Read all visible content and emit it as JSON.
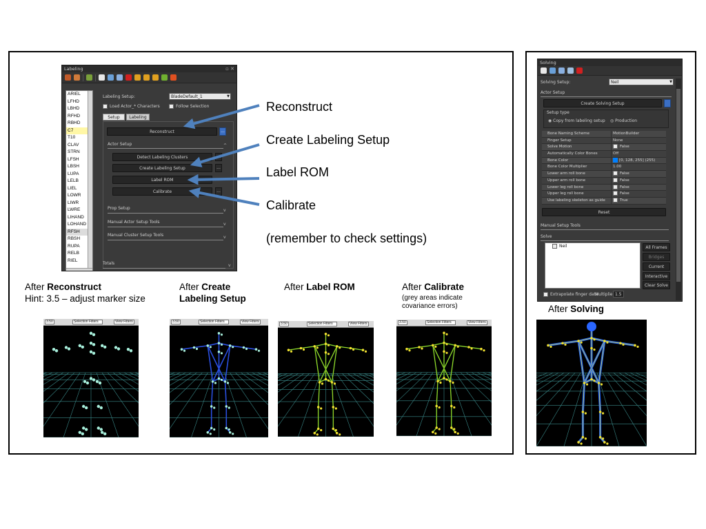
{
  "labeling_panel": {
    "title": "Labeling",
    "setup_label": "Labeling Setup:",
    "setup_value": "BladeDefault_1",
    "load_actor_label": "Load Actor_* Characters",
    "follow_selection_label": "Follow Selection",
    "tabs": [
      "Setup",
      "Labeling"
    ],
    "reconstruct_label": "Reconstruct",
    "actor_setup_label": "Actor Setup",
    "detect_clusters_label": "Detect Labeling Clusters",
    "create_setup_label": "Create Labeling Setup",
    "label_rom_label": "Label ROM",
    "calibrate_label": "Calibrate",
    "prop_setup_label": "Prop Setup",
    "manual_actor_label": "Manual Actor Setup Tools",
    "manual_cluster_label": "Manual Cluster Setup Tools",
    "totals_label": "Totals",
    "dots": "...",
    "markers": [
      "ARIEL",
      "LFHD",
      "LBHD",
      "RFHD",
      "RBHD",
      "C7",
      "T10",
      "CLAV",
      "STRN",
      "LFSH",
      "LBSH",
      "LUPA",
      "LELB",
      "LIEL",
      "LOWR",
      "LIWR",
      "LWRE",
      "LIHAND",
      "LOHAND",
      "RFSH",
      "RBSH",
      "RUPA",
      "RELB",
      "RIEL"
    ]
  },
  "annotations": {
    "reconstruct": "Reconstruct",
    "create_setup": "Create Labeling Setup",
    "label_rom": "Label ROM",
    "calibrate": "Calibrate",
    "remember": "(remember to check settings)"
  },
  "captions": {
    "c1_pre": "After ",
    "c1_bold": "Reconstruct",
    "c1_hint": "Hint: 3.5 – adjust marker size",
    "c2_pre": "After ",
    "c2_bold1": "Create",
    "c2_bold2": "Labeling Setup",
    "c3_pre": "After ",
    "c3_bold": "Label ROM",
    "c4_pre": "After ",
    "c4_bold": "Calibrate",
    "c4_note1": "(grey areas indicate",
    "c4_note2": "covariance errors)",
    "c5_pre": "After ",
    "c5_bold": "Solving"
  },
  "viewport_bar": {
    "marker_size": "3.50",
    "selection_filters": "Selection Filters",
    "view_filters": "View Filters"
  },
  "solving_panel": {
    "title": "Solving",
    "setup_label": "Solving Setup:",
    "setup_value": "Neil",
    "actor_setup_label": "Actor Setup",
    "create_solving_label": "Create Solving Setup",
    "setup_type_label": "Setup type",
    "copy_option": "Copy from labeling setup",
    "production_option": "Production",
    "properties": [
      {
        "k": "Bone Naming Scheme",
        "v": "MotionBuilder"
      },
      {
        "k": "Finger Setup",
        "v": "None"
      },
      {
        "k": "Solve Motion",
        "v": "False"
      },
      {
        "k": "Automatically Color Bones",
        "v": "Off"
      },
      {
        "k": "Bone Color",
        "v": "[0, 128, 255] (255)"
      },
      {
        "k": "Bone Color Multiplier",
        "v": "1.00"
      },
      {
        "k": "Lower arm roll bone",
        "v": "False"
      },
      {
        "k": "Upper arm roll bone",
        "v": "False"
      },
      {
        "k": "Lower leg roll bone",
        "v": "False"
      },
      {
        "k": "Upper leg roll bone",
        "v": "False"
      },
      {
        "k": "Use labeling skeleton as guide",
        "v": "True"
      }
    ],
    "reset_label": "Reset",
    "manual_tools_label": "Manual Setup Tools",
    "solve_label": "Solve",
    "subject": "Neil",
    "all_frames": "All Frames",
    "bridges": "Bridges",
    "current_frame": "Current Frame",
    "interactive": "Interactive",
    "clear_solve": "Clear Solve",
    "extrapolate_label": "Extrapolate finger data",
    "multiplier_label": "Multiplier:",
    "multiplier_value": "1.5",
    "bone_color_hex": "#0080ff"
  }
}
